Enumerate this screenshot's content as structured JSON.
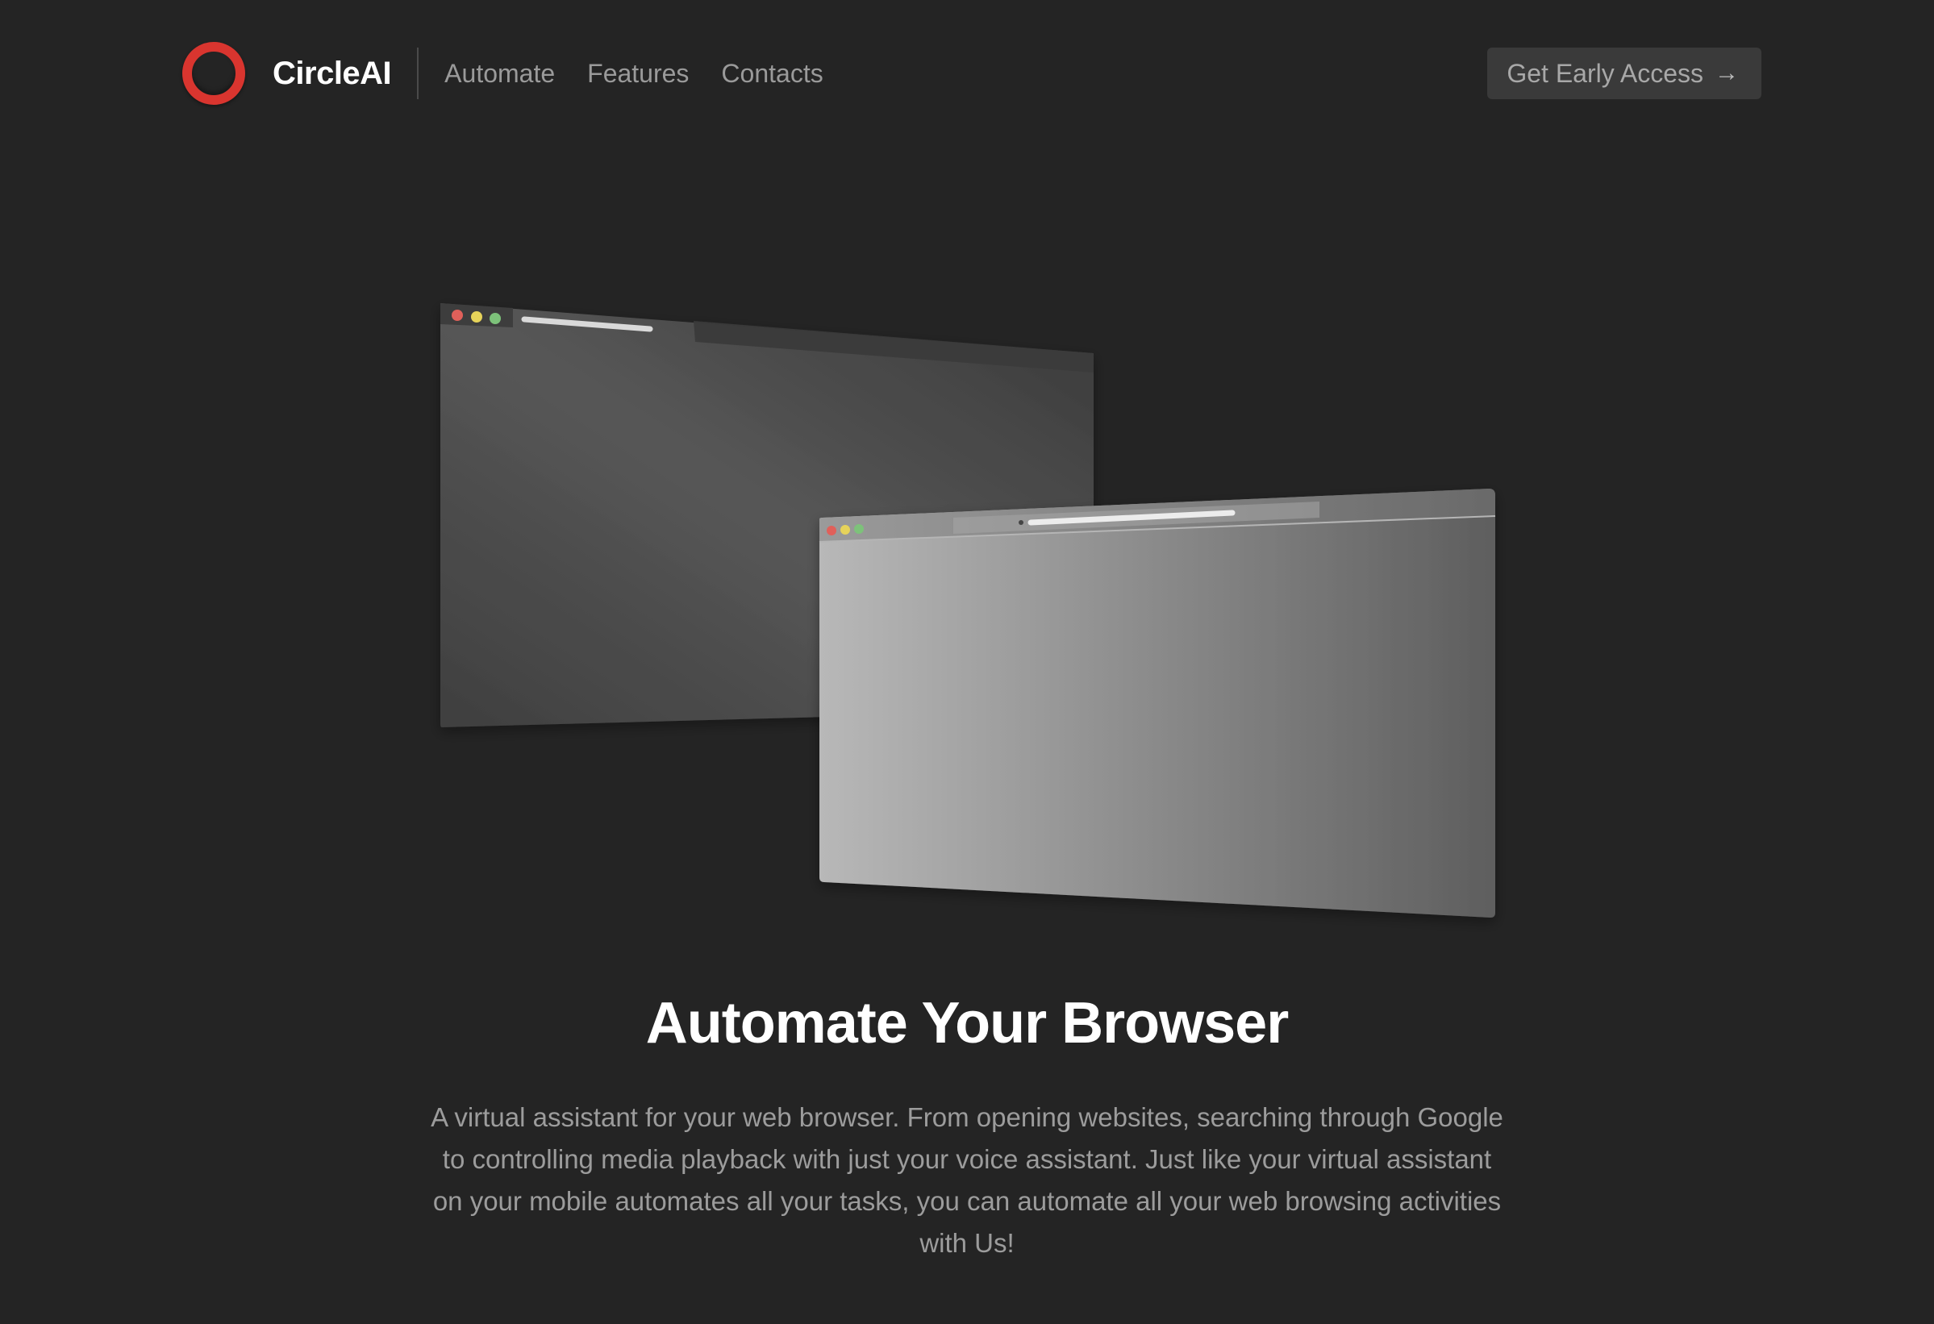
{
  "nav": {
    "brand": "CircleAI",
    "links": [
      "Automate",
      "Features",
      "Contacts"
    ],
    "cta_label": "Get Early Access",
    "cta_icon": "arrow-right-icon"
  },
  "hero": {
    "title": "Automate Your Browser",
    "description": "A virtual assistant for your web browser. From opening websites, searching through Google to controlling media playback with just your voice assistant. Just like your virtual assistant on your mobile automates all your tasks, you can automate all your web browsing activities with Us!"
  },
  "colors": {
    "background": "#242424",
    "brand_accent": "#d9352f",
    "traffic_red": "#e0605a",
    "traffic_yellow": "#e6d35a",
    "traffic_green": "#7dc27a"
  }
}
